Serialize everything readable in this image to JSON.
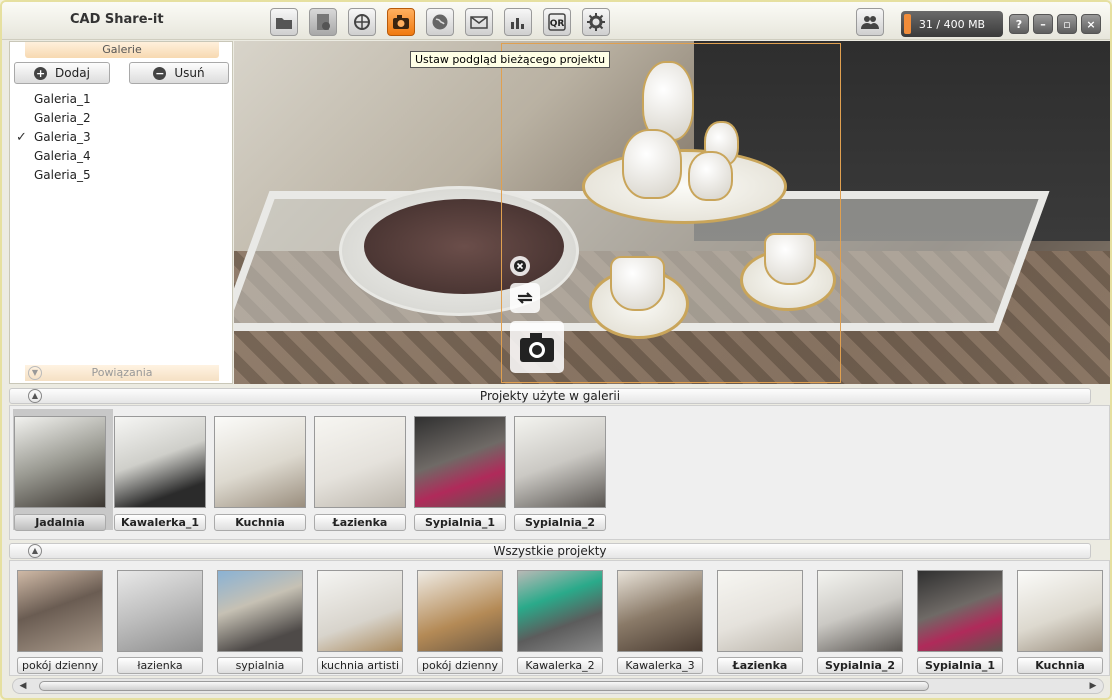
{
  "app": {
    "title": "CAD Share-it"
  },
  "toolbar": {
    "tooltip": "Ustaw podgląd bieżącego projektu",
    "storage": "31 / 400 MB",
    "storage_fraction": 0.0775,
    "help": "?",
    "minimize": "–",
    "maximize": "▫",
    "close": "×",
    "icons": [
      "folder-icon",
      "pdf-icon",
      "globe-share-icon",
      "camera-icon",
      "earth-icon",
      "mail-icon",
      "stats-icon",
      "qr-icon",
      "gear-icon"
    ]
  },
  "gallery": {
    "header": "Galerie",
    "add_label": "Dodaj",
    "remove_label": "Usuń",
    "items": [
      "Galeria_1",
      "Galeria_2",
      "Galeria_3",
      "Galeria_4",
      "Galeria_5"
    ],
    "selected_index": 2,
    "related": "Powiązania"
  },
  "used_projects": {
    "header": "Projekty użyte w galerii",
    "items": [
      "Jadalnia",
      "Kawalerka_1",
      "Kuchnia",
      "Łazienka",
      "Sypialnia_1",
      "Sypialnia_2"
    ]
  },
  "all_projects": {
    "header": "Wszystkie projekty",
    "items": [
      "pokój dzienny",
      "łazienka",
      "sypialnia",
      "kuchnia artisti",
      "pokój dzienny",
      "Kawalerka_2",
      "Kawalerka_3",
      "Łazienka",
      "Sypialnia_2",
      "Sypialnia_1",
      "Kuchnia"
    ]
  },
  "colors": {
    "accent": "#f07a10",
    "selection_border": "#e0a050",
    "bar_fill": "#f08c3a"
  }
}
